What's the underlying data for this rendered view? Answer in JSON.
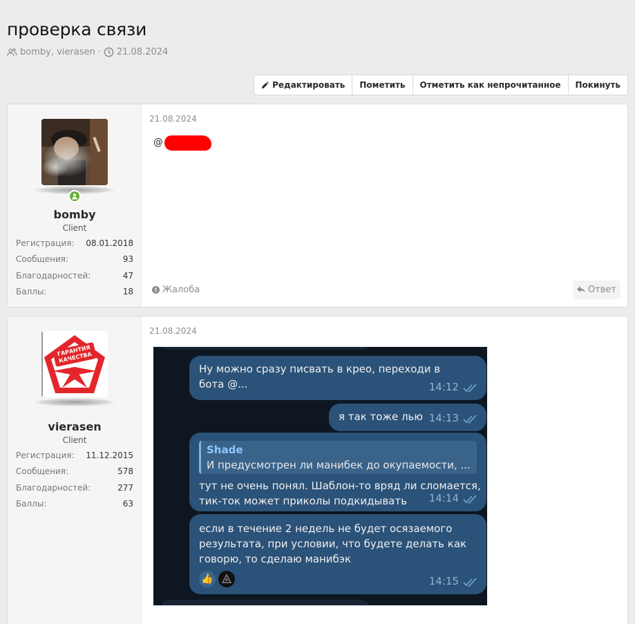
{
  "thread": {
    "title": "проверка связи",
    "participants": "bomby, vierasen",
    "separator": "·",
    "date": "21.08.2024"
  },
  "toolbar": {
    "edit_label": "Редактировать",
    "mark_label": "Пометить",
    "mark_unread_label": "Отметить как непрочитанное",
    "leave_label": "Покинуть"
  },
  "posts": [
    {
      "username": "bomby",
      "user_title": "Client",
      "stats": [
        {
          "label": "Регистрация:",
          "value": "08.01.2018"
        },
        {
          "label": "Сообщения:",
          "value": "93"
        },
        {
          "label": "Благодарностей:",
          "value": "47"
        },
        {
          "label": "Баллы:",
          "value": "18"
        }
      ],
      "date": "21.08.2024",
      "body_prefix": "@",
      "report_label": "Жалоба",
      "reply_label": "Ответ"
    },
    {
      "username": "vierasen",
      "user_title": "Client",
      "avatar_text": [
        "ГАРАНТИЯ",
        "КАЧЕСТВА"
      ],
      "stats": [
        {
          "label": "Регистрация:",
          "value": "11.12.2015"
        },
        {
          "label": "Сообщения:",
          "value": "578"
        },
        {
          "label": "Благодарностей:",
          "value": "277"
        },
        {
          "label": "Баллы:",
          "value": "63"
        }
      ],
      "date": "21.08.2024",
      "chat": {
        "messages": [
          {
            "text": "Ну можно сразу писвать в крео, переходи в бота @...",
            "time": "14:12"
          },
          {
            "text": "я так тоже лью",
            "time": "14:13"
          },
          {
            "quote_name": "Shade",
            "quote_text": "И предусмотрен ли манибек до окупаемости, ...",
            "text": "тут не очень понял. Шаблон-то вряд ли сломается, тик-ток может приколы подкидывать",
            "time": "14:14"
          },
          {
            "text": "если в течение 2 недель не будет осязаемого результата, при условии, что будете делать как говорю, то сделаю манибэк",
            "time": "14:15",
            "reactions": [
              "thumbs-up",
              "dark-avatar"
            ]
          }
        ]
      }
    }
  ],
  "colors": {
    "online": "#63b132",
    "tg_background": "#0e1621",
    "tg_bubble": "#2b5278",
    "redaction": "#ff0000"
  }
}
